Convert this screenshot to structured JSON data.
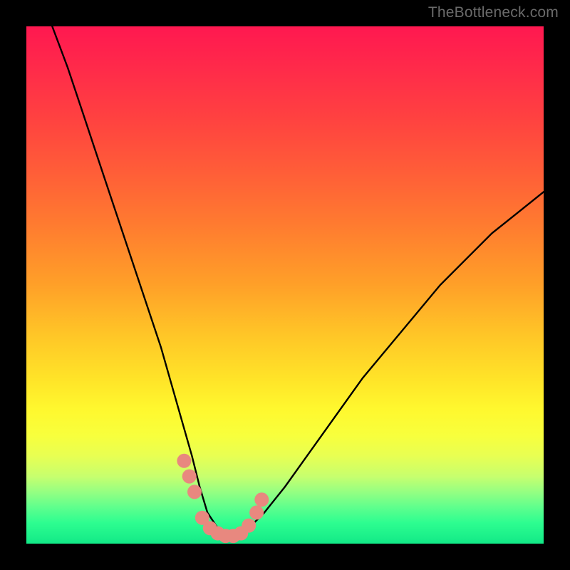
{
  "watermark": "TheBottleneck.com",
  "chart_data": {
    "type": "line",
    "title": "",
    "xlabel": "",
    "ylabel": "",
    "xlim": [
      0,
      100
    ],
    "ylim": [
      0,
      100
    ],
    "grid": false,
    "series": [
      {
        "name": "bottleneck-curve",
        "x": [
          5,
          8,
          11,
          14,
          17,
          20,
          23,
          26,
          28,
          30,
          32,
          33.5,
          35,
          37,
          39,
          41,
          43,
          46,
          50,
          55,
          60,
          65,
          70,
          75,
          80,
          85,
          90,
          95,
          100
        ],
        "values": [
          100,
          92,
          83,
          74,
          65,
          56,
          47,
          38,
          31,
          24,
          17,
          11,
          6,
          3,
          1,
          1,
          3,
          6,
          11,
          18,
          25,
          32,
          38,
          44,
          50,
          55,
          60,
          64,
          68
        ]
      }
    ],
    "markers": {
      "name": "highlight-dots",
      "color": "#e8887f",
      "points": [
        {
          "x": 30.5,
          "y": 16
        },
        {
          "x": 31.5,
          "y": 13
        },
        {
          "x": 32.5,
          "y": 10
        },
        {
          "x": 34.0,
          "y": 5
        },
        {
          "x": 35.5,
          "y": 3
        },
        {
          "x": 37.0,
          "y": 2
        },
        {
          "x": 38.5,
          "y": 1.5
        },
        {
          "x": 40.0,
          "y": 1.5
        },
        {
          "x": 41.5,
          "y": 2
        },
        {
          "x": 43.0,
          "y": 3.5
        },
        {
          "x": 44.5,
          "y": 6
        },
        {
          "x": 45.5,
          "y": 8.5
        }
      ]
    },
    "background_gradient": {
      "top": "#ff1850",
      "mid": "#ffe328",
      "bottom": "#12e987"
    }
  }
}
